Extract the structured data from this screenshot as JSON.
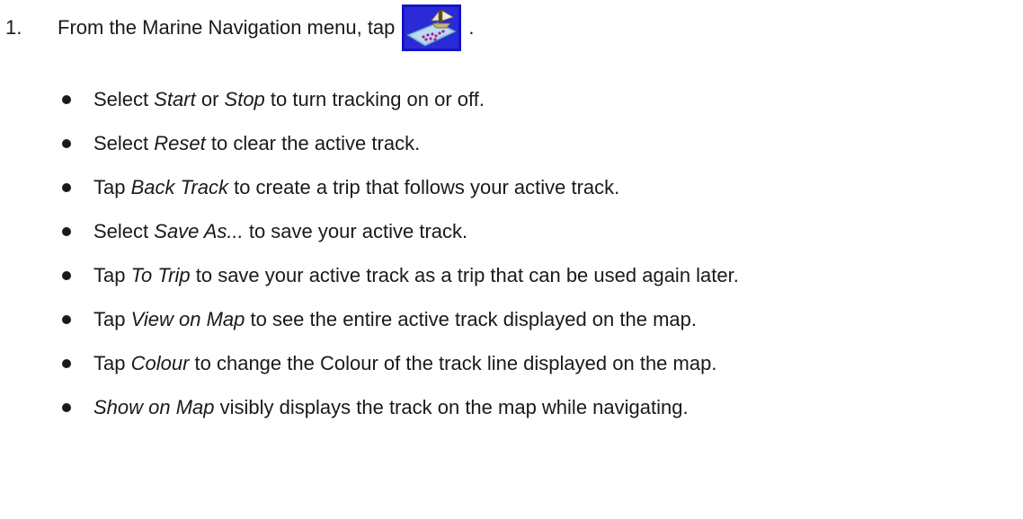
{
  "step": {
    "number": "1.",
    "text": "From the Marine Navigation menu, tap",
    "icon": "track-manager-icon",
    "period": "."
  },
  "bullets": [
    {
      "pre": "Select ",
      "em": "Start",
      "mid": " or ",
      "em2": "Stop",
      "post": " to turn tracking on or off."
    },
    {
      "pre": "Select ",
      "em": "Reset",
      "mid": "",
      "em2": "",
      "post": " to clear the active track."
    },
    {
      "pre": "Tap ",
      "em": "Back Track",
      "mid": "",
      "em2": "",
      "post": " to create a trip that follows your active track."
    },
    {
      "pre": "Select ",
      "em": "Save As...",
      "mid": "",
      "em2": "",
      "post": " to save your active track."
    },
    {
      "pre": "Tap ",
      "em": "To Trip",
      "mid": "",
      "em2": "",
      "post": " to save your active track as a trip that can be used again later."
    },
    {
      "pre": "Tap ",
      "em": "View on Map",
      "mid": "",
      "em2": "",
      "post": " to see the entire active track displayed on the map."
    },
    {
      "pre": "Tap ",
      "em": "Colour",
      "mid": "",
      "em2": "",
      "post": " to change the Colour of the track line displayed on the map."
    },
    {
      "pre": "",
      "em": "Show on Map",
      "mid": "",
      "em2": "",
      "post": " visibly displays the track on the map while navigating."
    }
  ]
}
